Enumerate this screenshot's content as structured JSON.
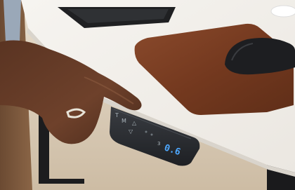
{
  "scene": {
    "description_visible_elements": [
      "desk",
      "keyboard",
      "mouse-pad",
      "mouse",
      "hand",
      "control-panel"
    ]
  },
  "control_panel": {
    "button_t_label": "T",
    "button_m_label": "M",
    "button_up_label": "△",
    "button_down_label": "▽",
    "preset_label": "3",
    "height_display": "0.6"
  },
  "colors": {
    "desk_top": "#f4f1ec",
    "desk_edge": "#e4e0da",
    "mouse_pad": "#7a3e24",
    "panel": "#2a2d31",
    "display_digits": "#4ea8ff",
    "floor": "#d8cbb8"
  }
}
